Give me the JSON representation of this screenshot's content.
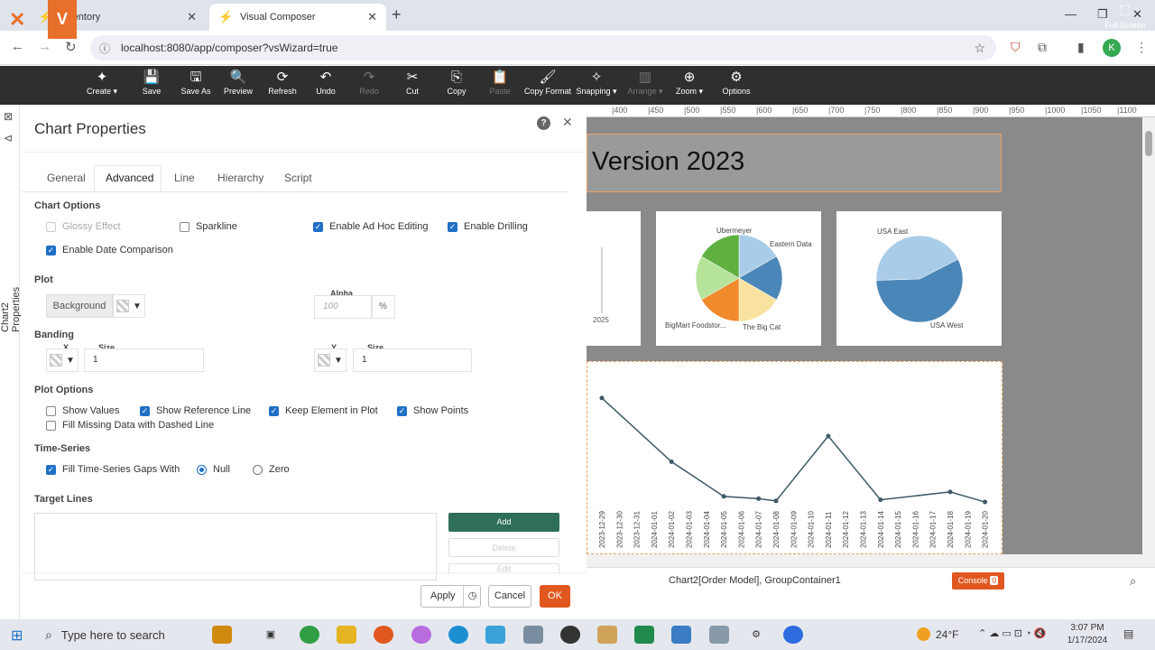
{
  "browser": {
    "tabs": [
      {
        "label": "Inventory",
        "active": false
      },
      {
        "label": "Visual Composer",
        "active": true
      }
    ],
    "url": "localhost:8080/app/composer?vsWizard=true",
    "profile_initial": "K"
  },
  "toolbar": {
    "buttons": [
      {
        "label": "Create",
        "icon": "sparkle-icon",
        "dropdown": true,
        "enabled": true
      },
      {
        "label": "Save",
        "icon": "save-icon",
        "enabled": true
      },
      {
        "label": "Save As",
        "icon": "save-as-icon",
        "enabled": true
      },
      {
        "label": "Preview",
        "icon": "preview-icon",
        "enabled": true
      },
      {
        "label": "Refresh",
        "icon": "refresh-icon",
        "enabled": true
      },
      {
        "label": "Undo",
        "icon": "undo-icon",
        "enabled": true
      },
      {
        "label": "Redo",
        "icon": "redo-icon",
        "enabled": false
      },
      {
        "label": "Cut",
        "icon": "scissors-icon",
        "enabled": true
      },
      {
        "label": "Copy",
        "icon": "copy-icon",
        "enabled": true
      },
      {
        "label": "Paste",
        "icon": "paste-icon",
        "enabled": false
      },
      {
        "label": "Copy Format",
        "icon": "paint-roller-icon",
        "enabled": true
      },
      {
        "label": "Snapping",
        "icon": "snapping-icon",
        "dropdown": true,
        "enabled": true
      },
      {
        "label": "Arrange",
        "icon": "arrange-icon",
        "dropdown": true,
        "enabled": false
      },
      {
        "label": "Zoom",
        "icon": "zoom-icon",
        "dropdown": true,
        "enabled": true
      },
      {
        "label": "Options",
        "icon": "gear-icon",
        "enabled": true
      }
    ],
    "fullscreen_label": "Full Screen"
  },
  "side_panel_label": "Chart2 Properties",
  "dialog": {
    "title": "Chart Properties",
    "tabs": [
      "General",
      "Advanced",
      "Line",
      "Hierarchy",
      "Script"
    ],
    "active_tab": "Advanced",
    "chart_options": {
      "heading": "Chart Options",
      "glossy": {
        "label": "Glossy Effect",
        "checked": false,
        "disabled": true
      },
      "sparkline": {
        "label": "Sparkline",
        "checked": false
      },
      "adhoc": {
        "label": "Enable Ad Hoc Editing",
        "checked": true
      },
      "drilling": {
        "label": "Enable Drilling",
        "checked": true
      },
      "date_comparison": {
        "label": "Enable Date Comparison",
        "checked": true
      }
    },
    "plot": {
      "heading": "Plot",
      "background_label": "Background",
      "alpha_label": "Alpha",
      "alpha_placeholder": "100",
      "alpha_unit": "%"
    },
    "banding": {
      "heading": "Banding",
      "x_label": "X",
      "y_label": "Y",
      "size_label": "Size",
      "x_size": "1",
      "y_size": "1"
    },
    "plot_options": {
      "heading": "Plot Options",
      "show_values": {
        "label": "Show Values",
        "checked": false
      },
      "show_reference_line": {
        "label": "Show Reference Line",
        "checked": true
      },
      "keep_element": {
        "label": "Keep Element in Plot",
        "checked": true
      },
      "show_points": {
        "label": "Show Points",
        "checked": true
      },
      "fill_missing": {
        "label": "Fill Missing Data with Dashed Line",
        "checked": false
      }
    },
    "time_series": {
      "heading": "Time-Series",
      "fill_gaps": {
        "label": "Fill Time-Series Gaps With",
        "checked": true
      },
      "null_label": "Null",
      "zero_label": "Zero",
      "selected": "Null"
    },
    "target_lines": {
      "heading": "Target Lines",
      "add_label": "Add",
      "delete_label": "Delete",
      "edit_label": "Edit"
    },
    "footer": {
      "apply": "Apply",
      "cancel": "Cancel",
      "ok": "OK"
    }
  },
  "canvas": {
    "ruler_ticks": [
      "400",
      "450",
      "500",
      "550",
      "600",
      "650",
      "700",
      "750",
      "800",
      "850",
      "900",
      "950",
      "1000",
      "1050",
      "1100"
    ],
    "title_text": "Version 2023",
    "pie1_labels": [
      "Ubermeyer",
      "Eastern Data",
      "BigMart Foodstor...",
      "The Big Cat"
    ],
    "pie2_labels": [
      "USA East",
      "USA West"
    ],
    "small_chart_label": "2025",
    "status_text": "Chart2[Order Model], GroupContainer1",
    "console_label": "Console",
    "console_count": "0"
  },
  "chart_data": [
    {
      "type": "pie",
      "labels": [
        "Ubermeyer",
        "Eastern Data",
        "The Big Cat",
        "BigMart Foodstor..."
      ],
      "slices": [
        {
          "label": "Ubermeyer",
          "value": 1,
          "color": "#a9cde8"
        },
        {
          "label": "Eastern Data",
          "value": 1,
          "color": "#4a86b8"
        },
        {
          "label": "",
          "value": 1,
          "color": "#fae3a0"
        },
        {
          "label": "The Big Cat",
          "value": 1,
          "color": "#f08a2c"
        },
        {
          "label": "BigMart Foodstor...",
          "value": 1,
          "color": "#b5e39a"
        },
        {
          "label": "",
          "value": 1,
          "color": "#5fb040"
        }
      ]
    },
    {
      "type": "pie",
      "labels": [
        "USA East",
        "USA West"
      ],
      "slices": [
        {
          "label": "USA East",
          "value": 57,
          "color": "#4a86b8"
        },
        {
          "label": "USA West",
          "value": 43,
          "color": "#a9cde8"
        }
      ]
    },
    {
      "type": "line",
      "x": [
        "2023-12-29",
        "2023-12-30",
        "2023-12-31",
        "2024-01-01",
        "2024-01-02",
        "2024-01-03",
        "2024-01-04",
        "2024-01-05",
        "2024-01-06",
        "2024-01-07",
        "2024-01-08",
        "2024-01-09",
        "2024-01-10",
        "2024-01-11",
        "2024-01-12",
        "2024-01-13",
        "2024-01-14",
        "2024-01-15",
        "2024-01-16",
        "2024-01-17",
        "2024-01-18",
        "2024-01-19",
        "2024-01-20"
      ],
      "points": [
        {
          "x": "2023-12-29",
          "y": 0.92
        },
        {
          "x": "2024-01-02",
          "y": 0.35
        },
        {
          "x": "2024-01-05",
          "y": 0.04
        },
        {
          "x": "2024-01-07",
          "y": 0.02
        },
        {
          "x": "2024-01-08",
          "y": 0.0
        },
        {
          "x": "2024-01-11",
          "y": 0.58
        },
        {
          "x": "2024-01-14",
          "y": 0.01
        },
        {
          "x": "2024-01-18",
          "y": 0.08
        },
        {
          "x": "2024-01-20",
          "y": -0.01
        }
      ],
      "color": "#3d5a66"
    }
  ],
  "taskbar": {
    "search_placeholder": "Type here to search",
    "weather": "24°F",
    "time": "3:07 PM",
    "date": "1/17/2024"
  }
}
